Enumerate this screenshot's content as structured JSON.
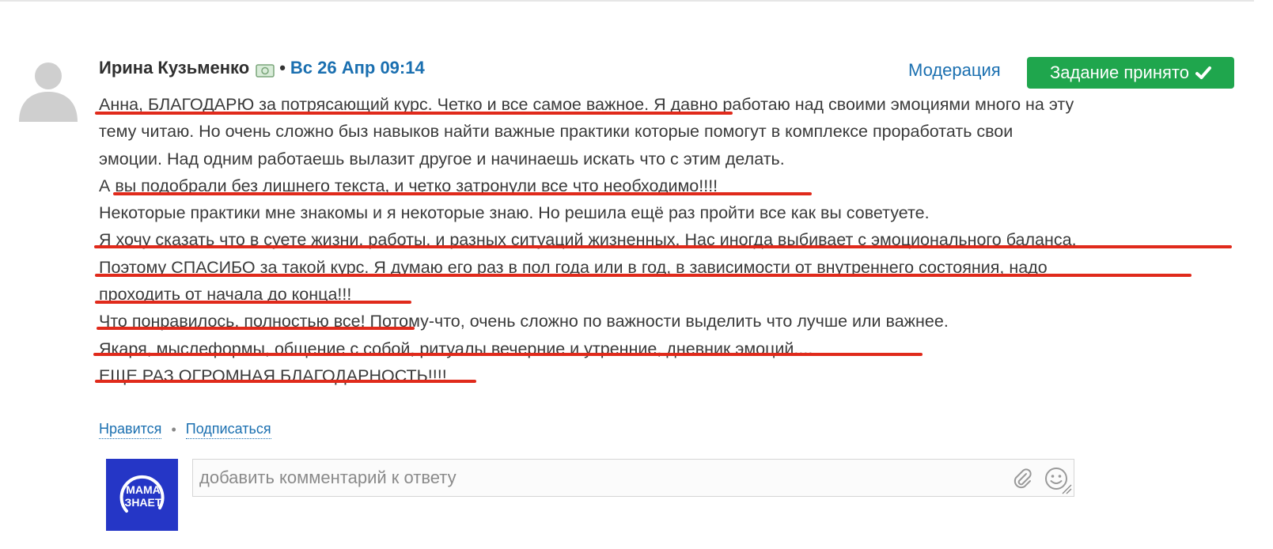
{
  "post": {
    "author": "Ирина Кузьменко",
    "separator": "•",
    "date": "Вс 26 Апр 09:14",
    "moderation_label": "Модерация",
    "status_button_label": "Задание принято"
  },
  "content": {
    "lines": [
      "Анна, БЛАГОДАРЮ за потрясающий курс. Четко и все самое важное. Я давно работаю над своими эмоциями много на эту",
      "тему читаю. Но очень сложно быз навыков найти важные практики которые помогут в комплексе проработать свои",
      "эмоции. Над одним работаешь вылазит другое и начинаешь искать что с этим делать.",
      "А вы подобрали без лишнего текста, и четко затронули все что необходимо!!!!",
      "Некоторые практики мне знакомы и я некоторые знаю. Но решила ещё раз пройти все как вы советуете.",
      "Я хочу сказать что в суете жизни, работы, и разных ситуаций жизненных. Нас иногда выбивает с эмоционального баланса.",
      "Поэтому СПАСИБО за такой курс. Я думаю его раз в пол года или в год, в зависимости от внутреннего состояния, надо",
      "проходить от начала до конца!!!",
      "Что понравилось, полностью все! Потому-что, очень сложно по важности выделить что лучше или важнее.",
      "Якаря, мыслеформы, общение с собой, ритуалы вечерние и утренние, дневник эмоций....",
      "ЕЩЕ РАЗ ОГРОМНАЯ БЛАГОДАРНОСТЬ!!!!"
    ]
  },
  "actions": {
    "like_label": "Нравится",
    "separator": "•",
    "subscribe_label": "Подписаться"
  },
  "comment": {
    "placeholder": "добавить комментарий к ответу"
  },
  "brand": {
    "logo_text_top": "МАМА",
    "logo_text_bottom": "ЗНАЕТ"
  },
  "colors": {
    "accent_link": "#1a6fb0",
    "accepted_green": "#1fa64d",
    "underline_red": "#e02a1b",
    "brand_blue": "#2536c6"
  },
  "icons": [
    "user-avatar-icon",
    "money-icon",
    "check-icon",
    "paperclip-icon",
    "smile-icon",
    "resize-handle-icon"
  ]
}
